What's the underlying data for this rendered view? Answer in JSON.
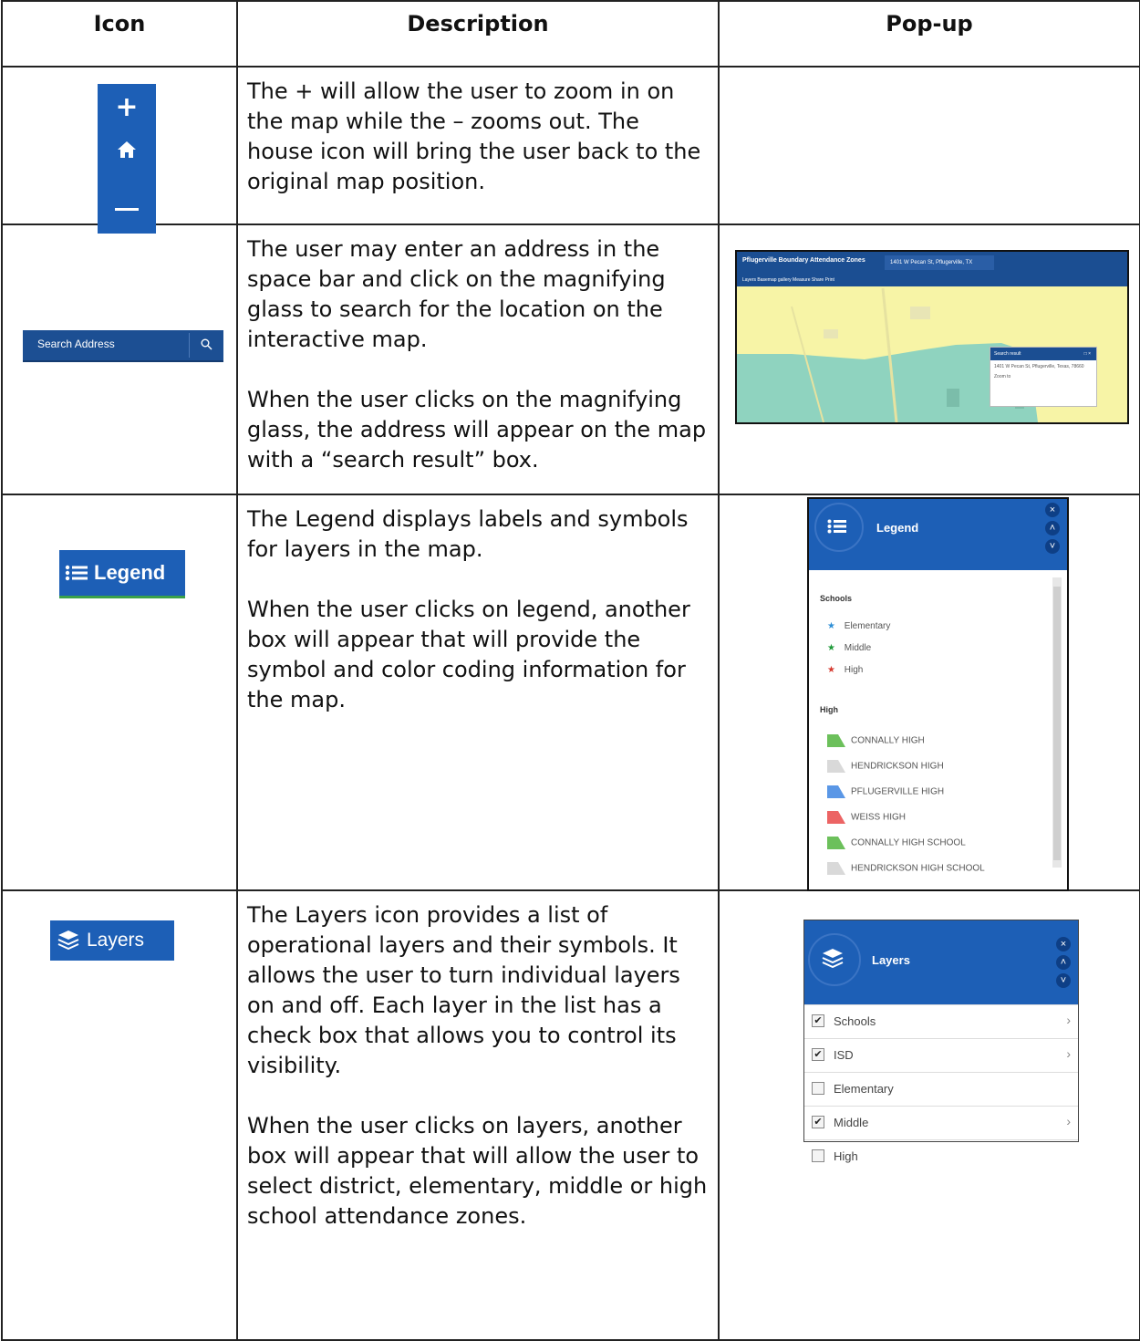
{
  "headers": {
    "icon": "Icon",
    "description": "Description",
    "popup": "Pop-up"
  },
  "rows": [
    {
      "desc": [
        "The + will allow the user to zoom in on the map while the – zooms out. The house icon will bring the user back to the original map position."
      ],
      "icon": {
        "plus": "+",
        "names": [
          "zoom-in-icon",
          "home-icon",
          "zoom-out-icon"
        ]
      }
    },
    {
      "desc": [
        "The user may enter an address in the space bar and click on the magnifying glass to search for the location on the interactive map.",
        "When the user clicks on the magnifying glass, the address will appear on the map with a “search result” box."
      ],
      "icon": {
        "placeholder": "Search Address"
      },
      "popup": {
        "app_title": "Pflugerville Boundary Attendance Zones",
        "address_value": "1401 W Pecan St, Pflugerville, TX",
        "toolbar": "Layers  Basemap gallery  Measure  Share  Print",
        "result_title": "Search result",
        "result_controls": "□ ×",
        "result_address": "1401 W Pecan St, Pflugerville, Texas, 78660",
        "result_zoom": "Zoom to"
      }
    },
    {
      "desc": [
        "The Legend displays labels and symbols for layers in the map.",
        "When the user clicks on legend, another box will appear that will provide the symbol and color coding information for the map."
      ],
      "icon": {
        "label": "Legend"
      },
      "popup": {
        "title": "Legend",
        "section_schools": "Schools",
        "schools": [
          "Elementary",
          "Middle",
          "High"
        ],
        "section_high": "High",
        "high_items": [
          "CONNALLY HIGH",
          "HENDRICKSON HIGH",
          "PFLUGERVILLE HIGH",
          "WEISS HIGH",
          "CONNALLY HIGH SCHOOL",
          "HENDRICKSON HIGH SCHOOL"
        ],
        "colors": {
          "star_elementary": "#2f8fd6",
          "star_middle": "#1f9a3a",
          "star_high": "#d63a2f",
          "connally": "#6cc05b",
          "hendrickson": "#d9d9d9",
          "pflugerville": "#5a97e6",
          "weiss": "#ec6464",
          "connally2": "#6cc05b",
          "hendrickson2": "#d9d9d9"
        }
      }
    },
    {
      "desc": [
        "The Layers icon provides a list of operational layers and their symbols. It allows the user to turn individual layers on and off. Each layer in the list has a check box that allows you to control its visibility.",
        "When the user clicks on layers, another box will appear that will allow the user to select district, elementary, middle or high school attendance zones."
      ],
      "icon": {
        "label": "Layers"
      },
      "popup": {
        "title": "Layers",
        "items": [
          {
            "name": "Schools",
            "checked": true,
            "arrow": true
          },
          {
            "name": "ISD",
            "checked": true,
            "arrow": true
          },
          {
            "name": "Elementary",
            "checked": false,
            "arrow": false
          },
          {
            "name": "Middle",
            "checked": true,
            "arrow": true
          },
          {
            "name": "High",
            "checked": false,
            "arrow": false
          }
        ]
      }
    }
  ],
  "colors": {
    "accent": "#1d5fb6",
    "accent_dark": "#1b4e92",
    "map_yellow": "#f7f4a6",
    "map_teal": "#8fd3bf"
  }
}
